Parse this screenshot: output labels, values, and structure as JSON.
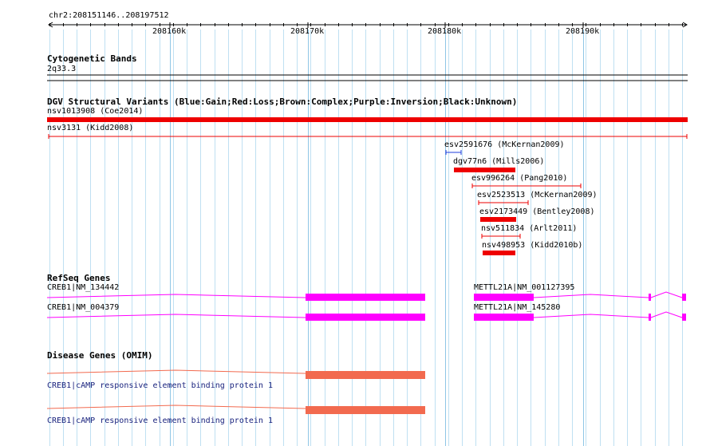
{
  "locus": "chr2:208151146..208197512",
  "ruler": {
    "ticks": [
      "208160k",
      "208170k",
      "208180k",
      "208190k"
    ]
  },
  "cytoband": {
    "title": "Cytogenetic Bands",
    "band": "2q33.3"
  },
  "dgv": {
    "title": "DGV Structural Variants (Blue:Gain;Red:Loss;Brown:Complex;Purple:Inversion;Black:Unknown)",
    "variants": [
      {
        "label": "nsv1013908 (Coe2014)",
        "color": "#ee0000",
        "style": "bar"
      },
      {
        "label": "nsv3131 (Kidd2008)",
        "color": "#ee0000",
        "style": "line"
      },
      {
        "label": "esv2591676 (McKernan2009)",
        "color": "#1e3cdc",
        "style": "line"
      },
      {
        "label": "dgv77n6 (Mills2006)",
        "color": "#ee0000",
        "style": "bar"
      },
      {
        "label": "esv996264 (Pang2010)",
        "color": "#ee0000",
        "style": "line"
      },
      {
        "label": "esv2523513 (McKernan2009)",
        "color": "#ee0000",
        "style": "line"
      },
      {
        "label": "esv2173449 (Bentley2008)",
        "color": "#ee0000",
        "style": "bar"
      },
      {
        "label": "nsv511834 (Arlt2011)",
        "color": "#ee0000",
        "style": "line"
      },
      {
        "label": "nsv498953 (Kidd2010b)",
        "color": "#ee0000",
        "style": "bar"
      }
    ]
  },
  "refseq": {
    "title": "RefSeq Genes",
    "genes": [
      {
        "label": "CREB1|NM_134442",
        "color": "#ff00ff"
      },
      {
        "label": "CREB1|NM_004379",
        "color": "#ff00ff"
      },
      {
        "label": "METTL21A|NM_001127395",
        "color": "#ff00ff"
      },
      {
        "label": "METTL21A|NM_145280",
        "color": "#ff00ff"
      }
    ]
  },
  "disease": {
    "title": "Disease Genes (OMIM)",
    "genes": [
      {
        "label": "CREB1|cAMP responsive element binding protein 1",
        "color": "#f26a4f"
      },
      {
        "label": "CREB1|cAMP responsive element binding protein 1",
        "color": "#f26a4f"
      }
    ]
  }
}
